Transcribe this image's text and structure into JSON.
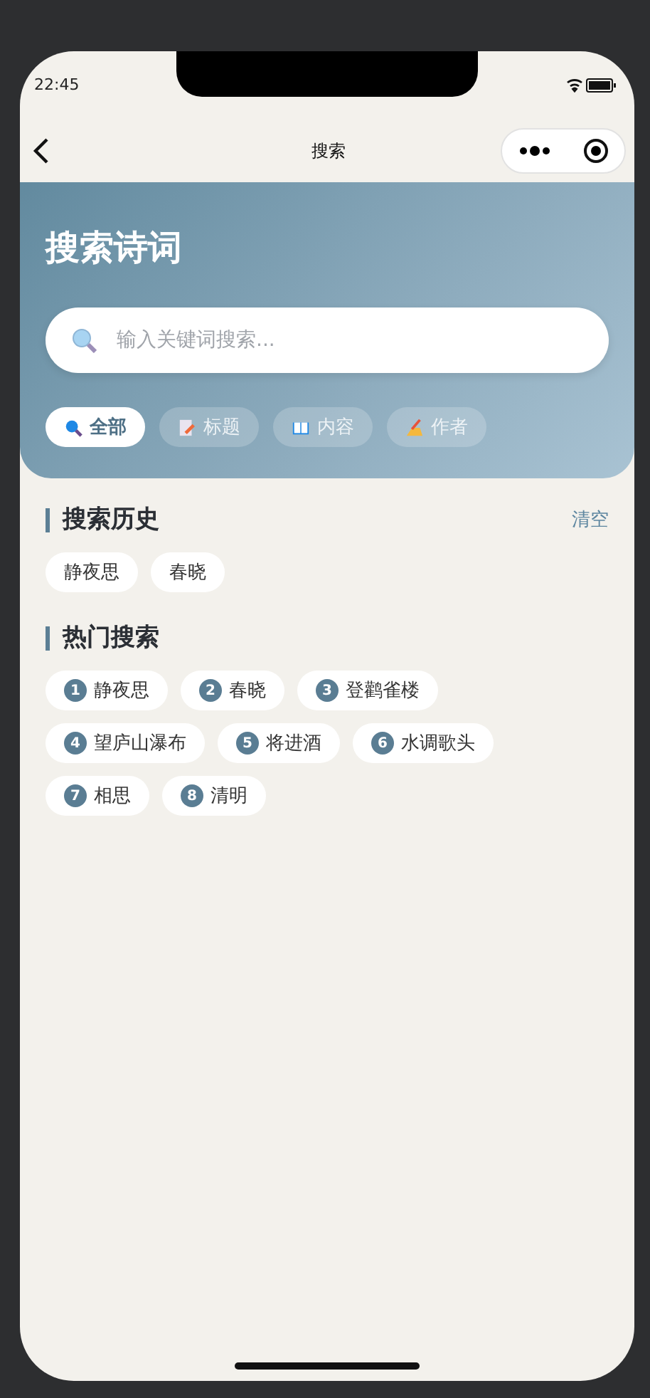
{
  "status_bar": {
    "time": "22:45"
  },
  "nav": {
    "title": "搜索"
  },
  "header": {
    "title": "搜索诗词",
    "search": {
      "placeholder": "输入关键词搜索..."
    },
    "filters": [
      {
        "label": "全部",
        "kind": "all",
        "selected": true
      },
      {
        "label": "标题",
        "kind": "title",
        "selected": false
      },
      {
        "label": "内容",
        "kind": "content",
        "selected": false
      },
      {
        "label": "作者",
        "kind": "author",
        "selected": false
      }
    ]
  },
  "history": {
    "title": "搜索历史",
    "action": "清空",
    "items": [
      "静夜思",
      "春晓"
    ]
  },
  "hot": {
    "title": "热门搜索",
    "items": [
      {
        "rank": "1",
        "label": "静夜思"
      },
      {
        "rank": "2",
        "label": "春晓"
      },
      {
        "rank": "3",
        "label": "登鹳雀楼"
      },
      {
        "rank": "4",
        "label": "望庐山瀑布"
      },
      {
        "rank": "5",
        "label": "将进酒"
      },
      {
        "rank": "6",
        "label": "水调歌头"
      },
      {
        "rank": "7",
        "label": "相思"
      },
      {
        "rank": "8",
        "label": "清明"
      }
    ]
  }
}
